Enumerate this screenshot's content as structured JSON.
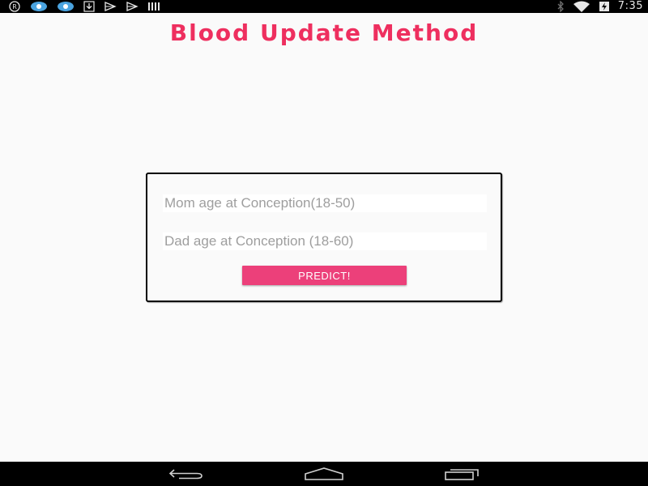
{
  "status_bar": {
    "time": "7:35",
    "left_icons": [
      "registered-icon",
      "app-icon",
      "app-icon",
      "download-icon",
      "play-store-icon",
      "play-store-icon",
      "barcode-icon"
    ],
    "right_icons": [
      "bluetooth-icon",
      "wifi-icon",
      "battery-charging-icon"
    ]
  },
  "app": {
    "title": "Blood Update Method",
    "accent_color": "#ee2f5f"
  },
  "form": {
    "mom_age_placeholder": "Mom age at Conception(18-50)",
    "dad_age_placeholder": "Dad age at Conception (18-60)",
    "predict_label": "PREDICT!",
    "button_color": "#ec407a"
  },
  "nav_bar": {
    "buttons": [
      "back-icon",
      "home-icon",
      "recents-icon"
    ]
  }
}
